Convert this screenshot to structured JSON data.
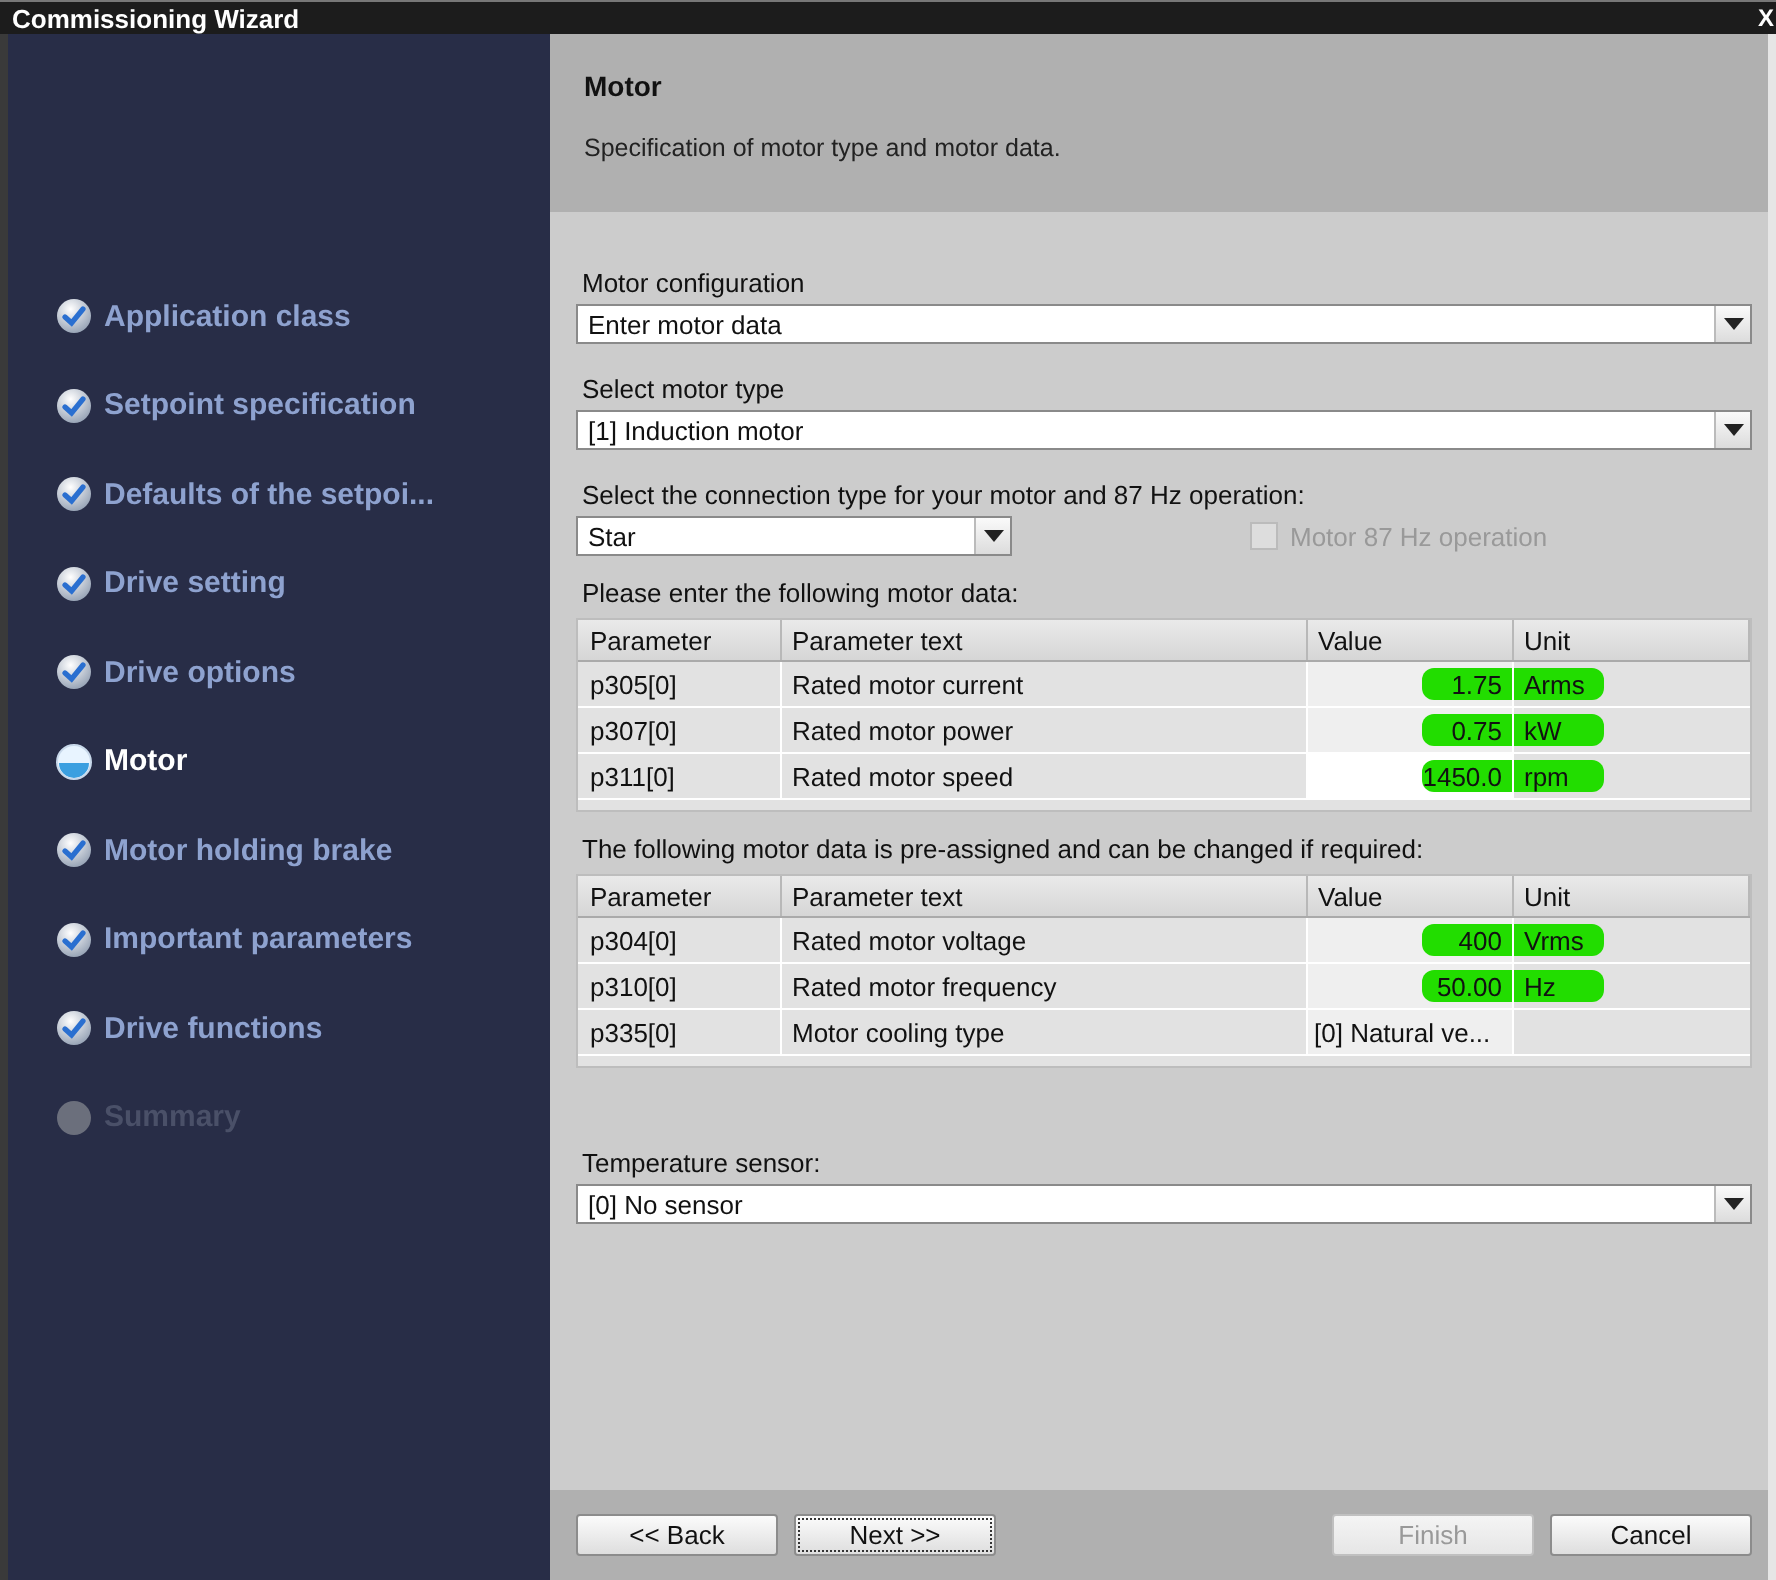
{
  "window": {
    "title": "Commissioning Wizard",
    "close": "X"
  },
  "steps": [
    {
      "label": "Application class",
      "done": true,
      "selected": false,
      "disabled": false
    },
    {
      "label": "Setpoint specification",
      "done": true,
      "selected": false,
      "disabled": false
    },
    {
      "label": "Defaults of the setpoi...",
      "done": true,
      "selected": false,
      "disabled": false
    },
    {
      "label": "Drive setting",
      "done": true,
      "selected": false,
      "disabled": false
    },
    {
      "label": "Drive options",
      "done": true,
      "selected": false,
      "disabled": false
    },
    {
      "label": "Motor",
      "done": false,
      "selected": true,
      "disabled": false
    },
    {
      "label": "Motor holding brake",
      "done": true,
      "selected": false,
      "disabled": false
    },
    {
      "label": "Important parameters",
      "done": true,
      "selected": false,
      "disabled": false
    },
    {
      "label": "Drive functions",
      "done": true,
      "selected": false,
      "disabled": false
    },
    {
      "label": "Summary",
      "done": false,
      "selected": false,
      "disabled": true
    }
  ],
  "header": {
    "title": "Motor",
    "subtitle": "Specification of motor type and motor data."
  },
  "motor_configuration": {
    "label": "Motor configuration",
    "value": "Enter motor data"
  },
  "motor_type": {
    "label": "Select motor type",
    "value": "[1] Induction motor"
  },
  "connection": {
    "label": "Select the connection type for your motor and 87 Hz operation:",
    "value": "Star",
    "checkbox": {
      "label": "Motor 87 Hz operation",
      "checked": false,
      "disabled": true
    }
  },
  "tables": [
    {
      "caption": "Please enter the following motor data:",
      "columns": [
        "Parameter",
        "Parameter text",
        "Value",
        "Unit"
      ],
      "rows": [
        {
          "parameter": "p305[0]",
          "text": "Rated motor current",
          "value": "1.75",
          "unit": "Arms",
          "highlighted": true,
          "editing": false
        },
        {
          "parameter": "p307[0]",
          "text": "Rated motor power",
          "value": "0.75",
          "unit": "kW",
          "highlighted": true,
          "editing": false
        },
        {
          "parameter": "p311[0]",
          "text": "Rated motor speed",
          "value": "1450.0",
          "unit": "rpm",
          "highlighted": true,
          "editing": true
        }
      ]
    },
    {
      "caption": "The following motor data is pre-assigned and can be changed if required:",
      "columns": [
        "Parameter",
        "Parameter text",
        "Value",
        "Unit"
      ],
      "rows": [
        {
          "parameter": "p304[0]",
          "text": "Rated motor voltage",
          "value": "400",
          "unit": "Vrms",
          "highlighted": true,
          "editing": false
        },
        {
          "parameter": "p310[0]",
          "text": "Rated motor frequency",
          "value": "50.00",
          "unit": "Hz",
          "highlighted": true,
          "editing": false
        },
        {
          "parameter": "p335[0]",
          "text": "Motor cooling type",
          "value": "[0] Natural ve...",
          "kind": "choice",
          "highlighted": false,
          "editing": false
        }
      ]
    }
  ],
  "temperature_sensor": {
    "label": "Temperature sensor:",
    "value": "[0] No sensor"
  },
  "nav_buttons": [
    {
      "label": "<< Back",
      "disabled": false,
      "focused": false
    },
    {
      "label": "Next >>",
      "disabled": false,
      "focused": true
    }
  ],
  "action_buttons": [
    {
      "label": "Finish",
      "disabled": true,
      "focused": false
    },
    {
      "label": "Cancel",
      "disabled": false,
      "focused": false
    }
  ]
}
